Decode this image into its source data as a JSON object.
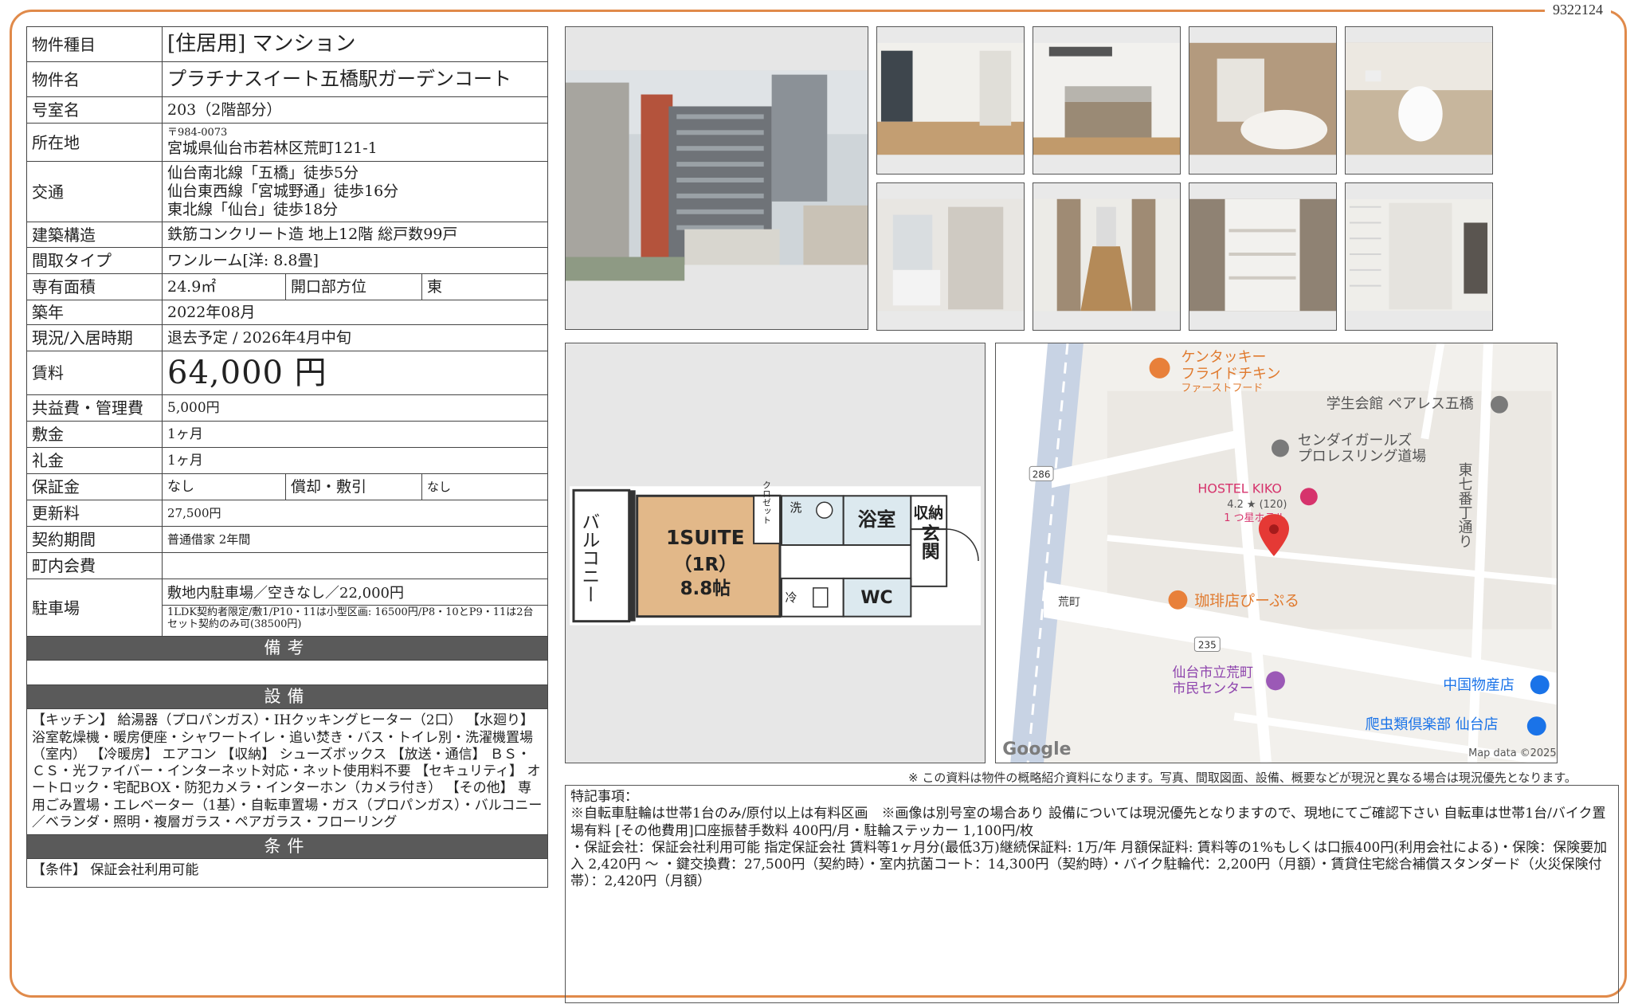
{
  "doc_id": "9322124",
  "property": {
    "type_label": "物件種目",
    "type_value": "[住居用]  マンション",
    "name_label": "物件名",
    "name_value": "プラチナスイート五橋駅ガーデンコート",
    "room_label": "号室名",
    "room_value": "203（2階部分）",
    "address_label": "所在地",
    "postal": "〒984-0073",
    "address": "宮城県仙台市若林区荒町121-1",
    "transport_label": "交通",
    "transport": [
      "仙台南北線「五橋」徒歩5分",
      "仙台東西線「宮城野通」徒歩16分",
      "東北線「仙台」徒歩18分"
    ],
    "structure_label": "建築構造",
    "structure_value": "鉄筋コンクリート造  地上12階  総戸数99戸",
    "layout_label": "間取タイプ",
    "layout_value": "ワンルーム[洋: 8.8畳]",
    "area_label": "専有面積",
    "area_value": "24.9㎡",
    "orientation_label": "開口部方位",
    "orientation_value": "東",
    "built_label": "築年",
    "built_value": "2022年08月",
    "status_label": "現況/入居時期",
    "status_value": "退去予定  /  2026年4月中旬",
    "rent_label": "賃料",
    "rent_value": "64,000 円",
    "mgmt_label": "共益費・管理費",
    "mgmt_value": "5,000円",
    "deposit_label": "敷金",
    "deposit_value": "1ヶ月",
    "key_money_label": "礼金",
    "key_money_value": "1ヶ月",
    "guarantee_label": "保証金",
    "guarantee_value": "なし",
    "amort_label": "償却・敷引",
    "amort_value": "なし",
    "renewal_label": "更新料",
    "renewal_value": "27,500円",
    "contract_label": "契約期間",
    "contract_value": "普通借家  2年間",
    "town_label": "町内会費",
    "town_value": "",
    "parking_label": "駐車場",
    "parking_value": "敷地内駐車場／空きなし／22,000円",
    "parking_note": "1LDK契約者限定/敷1/P10・11は小型区画: 16500円/P8・10とP9・11は2台セット契約のみ可(38500円)"
  },
  "sections": {
    "remarks_header": "備考",
    "equipment_header": "設備",
    "equipment_text": "【キッチン】 給湯器（プロパンガス）・IHクッキングヒーター（2口） 【水廻り】 浴室乾燥機・暖房便座・シャワートイレ・追い焚き・バス・トイレ別・洗濯機置場（室内） 【冷暖房】 エアコン 【収納】 シューズボックス 【放送・通信】 ＢＳ・ＣＳ・光ファイバー・インターネット対応・ネット使用料不要 【セキュリティ】 オートロック・宅配BOX・防犯カメラ・インターホン（カメラ付き） 【その他】 専用ごみ置場・エレベーター（1基）・自転車置場・ガス（プロパンガス）・バルコニー／ベランダ・照明・複層ガラス・ペアガラス・フローリング",
    "conditions_header": "条件",
    "conditions_text": "【条件】  保証会社利用可能"
  },
  "floorplan": {
    "room_name": "1SUITE",
    "room_type": "（1R）",
    "room_size": "8.8帖",
    "balcony": "バルコニー",
    "closet": "クロゼット",
    "wash": "洗",
    "bath": "浴室",
    "storage": "収納",
    "entrance": "玄関",
    "fridge": "冷",
    "wc": "WC"
  },
  "map": {
    "labels": {
      "kfc1": "ケンタッキー",
      "kfc2": "フライドチキン",
      "kfc3": "ファーストフード",
      "gakusei": "学生会館 ペアレス五橋",
      "sendai_girls1": "センダイガールズ",
      "sendai_girls2": "プロレスリング道場",
      "hostel": "HOSTEL KIKO",
      "hostel_rating": "4.2 ★ (120)",
      "hostel_star": "1 つ星ホテル",
      "route286": "286",
      "route235": "235",
      "aramachi": "荒町",
      "cafe": "珈琲店ぴーぷる",
      "center1": "仙台市立荒町",
      "center2": "市民センター",
      "chinese": "中国物産店",
      "reptile": "爬虫類倶楽部 仙台店",
      "street": "東七番丁通り",
      "google": "Google",
      "mapdata": "Map data ©2025"
    }
  },
  "footnote": "※ この資料は物件の概略紹介資料になります。写真、間取図面、設備、概要などが現況と異なる場合は現況優先となります。",
  "remarks_block": {
    "title": "特記事項：",
    "lines": [
      "※自転車駐輪は世帯1台のみ/原付以上は有料区画　※画像は別号室の場合あり  設備については現況優先となりますので、現地にてご確認下さい  自転車は世帯1台/バイク置場有料  [その他費用]口座振替手数料  400円/月・駐輪ステッカー  1,100円/枚",
      "・保証会社：保証会社利用可能  指定保証会社  賃料等1ヶ月分(最低3万)継続保証料: 1万/年  月額保証料: 賃料等の1%もしくは口振400円(利用会社による)・保険：保険要加入  2,420円  〜  ・鍵交換費：27,500円（契約時）・室内抗菌コート：14,300円（契約時）・バイク駐輪代：2,200円（月額）・賃貸住宅総合補償スタンダード（火災保険付帯）：2,420円（月額）"
    ]
  }
}
